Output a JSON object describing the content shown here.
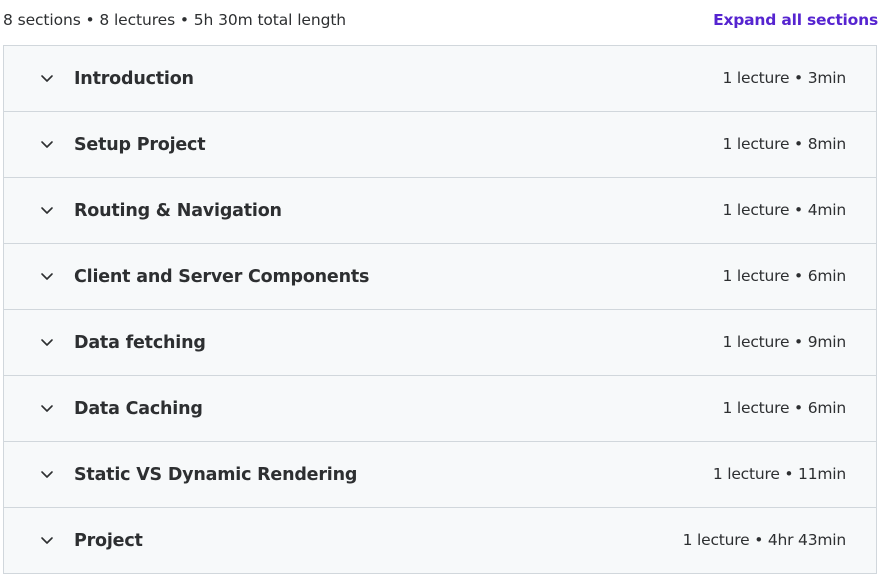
{
  "summary": {
    "text": "8 sections • 8 lectures • 5h 30m total length",
    "expand_label": "Expand all sections"
  },
  "colors": {
    "accent": "#5624d0",
    "section_bg": "#f7f9fa",
    "border": "#d1d7dc",
    "text": "#2d2f31"
  },
  "icons": {
    "section_toggle": "chevron-down-icon"
  },
  "sections": [
    {
      "title": "Introduction",
      "meta": "1 lecture • 3min"
    },
    {
      "title": "Setup Project",
      "meta": "1 lecture • 8min"
    },
    {
      "title": "Routing & Navigation",
      "meta": "1 lecture • 4min"
    },
    {
      "title": "Client and Server Components",
      "meta": "1 lecture • 6min"
    },
    {
      "title": "Data fetching",
      "meta": "1 lecture • 9min"
    },
    {
      "title": "Data Caching",
      "meta": "1 lecture • 6min"
    },
    {
      "title": "Static VS Dynamic Rendering",
      "meta": "1 lecture • 11min"
    },
    {
      "title": "Project",
      "meta": "1 lecture • 4hr 43min"
    }
  ]
}
